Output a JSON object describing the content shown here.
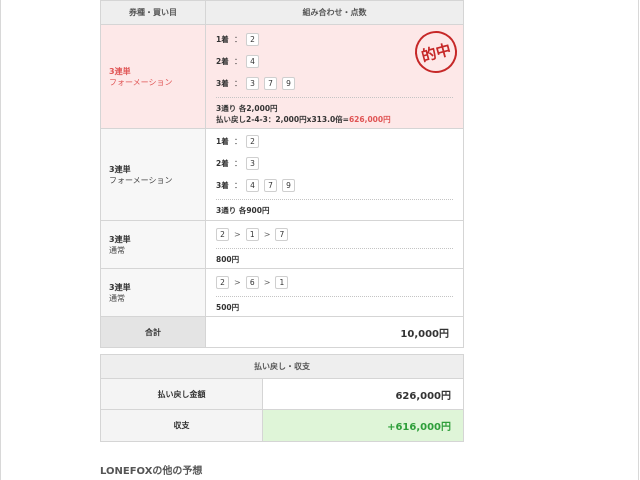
{
  "header": {
    "col1": "券種・買い目",
    "col2": "組み合わせ・点数"
  },
  "bets": [
    {
      "type": "3連単",
      "subtype": "フォーメーション",
      "hit": true,
      "stamp": "的中",
      "positions": [
        {
          "label": "1着",
          "nums": [
            "2"
          ]
        },
        {
          "label": "2着",
          "nums": [
            "4"
          ]
        },
        {
          "label": "3着",
          "nums": [
            "3",
            "7",
            "9"
          ]
        }
      ],
      "summary": "3通り 各2,000円",
      "payout_prefix": "払い戻し2-4-3：2,000円x313.0倍=",
      "payout_amount": "626,000円"
    },
    {
      "type": "3連単",
      "subtype": "フォーメーション",
      "positions": [
        {
          "label": "1着",
          "nums": [
            "2"
          ]
        },
        {
          "label": "2着",
          "nums": [
            "3"
          ]
        },
        {
          "label": "3着",
          "nums": [
            "4",
            "7",
            "9"
          ]
        }
      ],
      "summary": "3通り 各900円"
    },
    {
      "type": "3連単",
      "subtype": "通常",
      "sequence": [
        "2",
        "1",
        "7"
      ],
      "summary": "800円"
    },
    {
      "type": "3連単",
      "subtype": "通常",
      "sequence": [
        "2",
        "6",
        "1"
      ],
      "summary": "500円"
    }
  ],
  "arrow": ">",
  "colon": "：",
  "total": {
    "label": "合計",
    "value": "10,000円"
  },
  "payout": {
    "heading": "払い戻し・収支",
    "payback_label": "払い戻し金額",
    "payback_value": "626,000円",
    "balance_label": "収支",
    "balance_value": "+616,000円"
  },
  "others_heading": "LONEFOXの他の予想",
  "colors": {
    "hit_bg": "#fde8e8",
    "hit_text": "#e05454",
    "profit_bg": "#dff5d8",
    "profit_text": "#2e9e3a",
    "stamp": "#c62828"
  }
}
